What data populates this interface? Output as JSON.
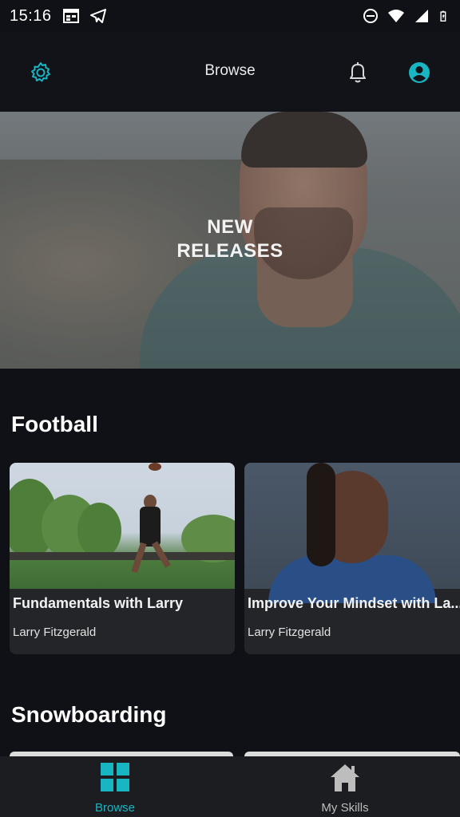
{
  "status_bar": {
    "time": "15:16",
    "icons": [
      "calendar-icon",
      "telegram-icon",
      "do-not-disturb-icon",
      "wifi-icon",
      "signal-icon",
      "battery-icon"
    ]
  },
  "app_bar": {
    "title": "Browse",
    "icons": [
      "gear-icon",
      "bell-icon",
      "account-icon"
    ]
  },
  "hero": {
    "label_line1": "NEW",
    "label_line2": "RELEASES"
  },
  "sections": [
    {
      "title": "Football",
      "cards": [
        {
          "title": "Fundamentals with Larry",
          "subtitle": "Larry Fitzgerald"
        },
        {
          "title": "Improve Your Mindset with La...",
          "subtitle": "Larry Fitzgerald"
        }
      ]
    },
    {
      "title": "Snowboarding",
      "cards": []
    }
  ],
  "bottom_nav": {
    "items": [
      {
        "label": "Browse",
        "icon": "grid-icon",
        "active": true
      },
      {
        "label": "My Skills",
        "icon": "home-icon",
        "active": false
      }
    ]
  },
  "colors": {
    "accent": "#18b5c2",
    "background": "#0f1116",
    "card": "#232529"
  }
}
